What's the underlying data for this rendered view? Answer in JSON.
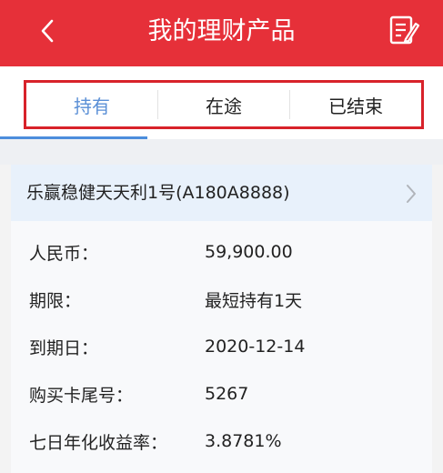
{
  "header": {
    "title": "我的理财产品",
    "back_icon": "chevron-left-icon",
    "edit_icon": "edit-note-icon",
    "bg_color": "#e63039"
  },
  "tabs": [
    {
      "label": "持有",
      "active": true
    },
    {
      "label": "在途",
      "active": false
    },
    {
      "label": "已结束",
      "active": false
    }
  ],
  "product": {
    "name": "乐赢稳健天天利1号(A180A8888)",
    "chevron_icon": "chevron-right-icon",
    "fields": [
      {
        "label": "人民币：",
        "value": "59,900.00"
      },
      {
        "label": "期限：",
        "value": "最短持有1天"
      },
      {
        "label": "到期日：",
        "value": "2020-12-14"
      },
      {
        "label": "购买卡尾号：",
        "value": "5267"
      },
      {
        "label": "七日年化收益率：",
        "value": "3.8781%"
      }
    ]
  },
  "colors": {
    "accent_blue": "#5a8fd6",
    "highlight_border": "#d8222a"
  }
}
